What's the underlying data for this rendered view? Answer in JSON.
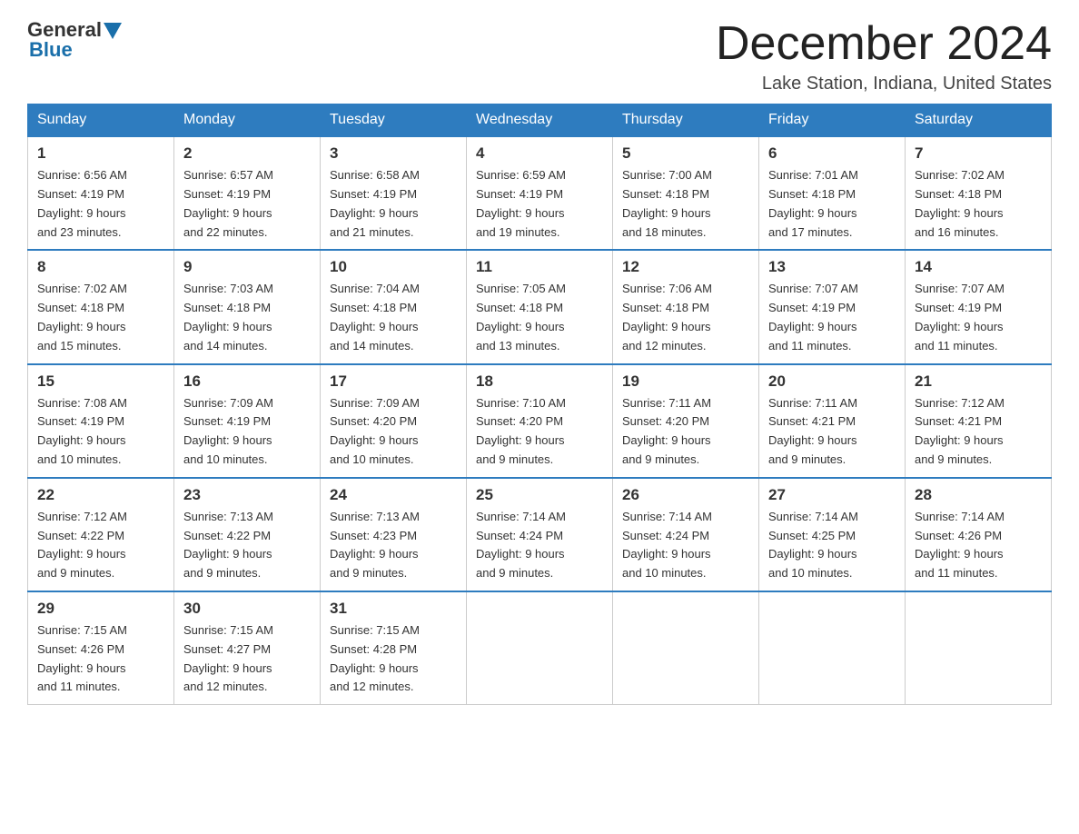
{
  "header": {
    "logo_general": "General",
    "logo_blue": "Blue",
    "title": "December 2024",
    "location": "Lake Station, Indiana, United States"
  },
  "days_of_week": [
    "Sunday",
    "Monday",
    "Tuesday",
    "Wednesday",
    "Thursday",
    "Friday",
    "Saturday"
  ],
  "weeks": [
    [
      {
        "day": "1",
        "sunrise": "6:56 AM",
        "sunset": "4:19 PM",
        "daylight": "9 hours and 23 minutes."
      },
      {
        "day": "2",
        "sunrise": "6:57 AM",
        "sunset": "4:19 PM",
        "daylight": "9 hours and 22 minutes."
      },
      {
        "day": "3",
        "sunrise": "6:58 AM",
        "sunset": "4:19 PM",
        "daylight": "9 hours and 21 minutes."
      },
      {
        "day": "4",
        "sunrise": "6:59 AM",
        "sunset": "4:19 PM",
        "daylight": "9 hours and 19 minutes."
      },
      {
        "day": "5",
        "sunrise": "7:00 AM",
        "sunset": "4:18 PM",
        "daylight": "9 hours and 18 minutes."
      },
      {
        "day": "6",
        "sunrise": "7:01 AM",
        "sunset": "4:18 PM",
        "daylight": "9 hours and 17 minutes."
      },
      {
        "day": "7",
        "sunrise": "7:02 AM",
        "sunset": "4:18 PM",
        "daylight": "9 hours and 16 minutes."
      }
    ],
    [
      {
        "day": "8",
        "sunrise": "7:02 AM",
        "sunset": "4:18 PM",
        "daylight": "9 hours and 15 minutes."
      },
      {
        "day": "9",
        "sunrise": "7:03 AM",
        "sunset": "4:18 PM",
        "daylight": "9 hours and 14 minutes."
      },
      {
        "day": "10",
        "sunrise": "7:04 AM",
        "sunset": "4:18 PM",
        "daylight": "9 hours and 14 minutes."
      },
      {
        "day": "11",
        "sunrise": "7:05 AM",
        "sunset": "4:18 PM",
        "daylight": "9 hours and 13 minutes."
      },
      {
        "day": "12",
        "sunrise": "7:06 AM",
        "sunset": "4:18 PM",
        "daylight": "9 hours and 12 minutes."
      },
      {
        "day": "13",
        "sunrise": "7:07 AM",
        "sunset": "4:19 PM",
        "daylight": "9 hours and 11 minutes."
      },
      {
        "day": "14",
        "sunrise": "7:07 AM",
        "sunset": "4:19 PM",
        "daylight": "9 hours and 11 minutes."
      }
    ],
    [
      {
        "day": "15",
        "sunrise": "7:08 AM",
        "sunset": "4:19 PM",
        "daylight": "9 hours and 10 minutes."
      },
      {
        "day": "16",
        "sunrise": "7:09 AM",
        "sunset": "4:19 PM",
        "daylight": "9 hours and 10 minutes."
      },
      {
        "day": "17",
        "sunrise": "7:09 AM",
        "sunset": "4:20 PM",
        "daylight": "9 hours and 10 minutes."
      },
      {
        "day": "18",
        "sunrise": "7:10 AM",
        "sunset": "4:20 PM",
        "daylight": "9 hours and 9 minutes."
      },
      {
        "day": "19",
        "sunrise": "7:11 AM",
        "sunset": "4:20 PM",
        "daylight": "9 hours and 9 minutes."
      },
      {
        "day": "20",
        "sunrise": "7:11 AM",
        "sunset": "4:21 PM",
        "daylight": "9 hours and 9 minutes."
      },
      {
        "day": "21",
        "sunrise": "7:12 AM",
        "sunset": "4:21 PM",
        "daylight": "9 hours and 9 minutes."
      }
    ],
    [
      {
        "day": "22",
        "sunrise": "7:12 AM",
        "sunset": "4:22 PM",
        "daylight": "9 hours and 9 minutes."
      },
      {
        "day": "23",
        "sunrise": "7:13 AM",
        "sunset": "4:22 PM",
        "daylight": "9 hours and 9 minutes."
      },
      {
        "day": "24",
        "sunrise": "7:13 AM",
        "sunset": "4:23 PM",
        "daylight": "9 hours and 9 minutes."
      },
      {
        "day": "25",
        "sunrise": "7:14 AM",
        "sunset": "4:24 PM",
        "daylight": "9 hours and 9 minutes."
      },
      {
        "day": "26",
        "sunrise": "7:14 AM",
        "sunset": "4:24 PM",
        "daylight": "9 hours and 10 minutes."
      },
      {
        "day": "27",
        "sunrise": "7:14 AM",
        "sunset": "4:25 PM",
        "daylight": "9 hours and 10 minutes."
      },
      {
        "day": "28",
        "sunrise": "7:14 AM",
        "sunset": "4:26 PM",
        "daylight": "9 hours and 11 minutes."
      }
    ],
    [
      {
        "day": "29",
        "sunrise": "7:15 AM",
        "sunset": "4:26 PM",
        "daylight": "9 hours and 11 minutes."
      },
      {
        "day": "30",
        "sunrise": "7:15 AM",
        "sunset": "4:27 PM",
        "daylight": "9 hours and 12 minutes."
      },
      {
        "day": "31",
        "sunrise": "7:15 AM",
        "sunset": "4:28 PM",
        "daylight": "9 hours and 12 minutes."
      },
      null,
      null,
      null,
      null
    ]
  ]
}
